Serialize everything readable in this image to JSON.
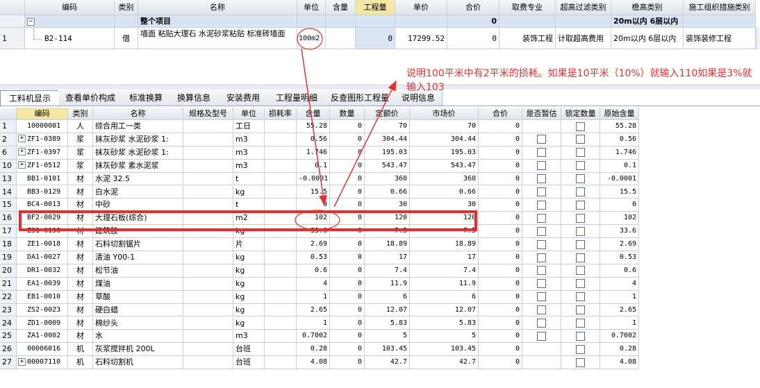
{
  "top_grid": {
    "columns": [
      "编码",
      "类别",
      "名称",
      "单位",
      "含量",
      "工程量",
      "单价",
      "合价",
      "取费专业",
      "超高过滤类别",
      "檐高类别",
      "施工组织措施类别"
    ],
    "group_row": {
      "minus": "−",
      "name": "整个项目",
      "total": "0",
      "eave": "20m以内 6层以内"
    },
    "item_row": {
      "row_num": "1",
      "code": "B2-114",
      "type": "借",
      "name": "墙面 粘贴大理石 水泥砂浆粘贴 标准砖墙面",
      "unit": "100m2",
      "quantity": "0",
      "unit_price": "17299.52",
      "total": "0",
      "fee_major": "装饰工程",
      "super_filter": "计取超高费用",
      "eave": "20m以内 6层以内",
      "measure_type": "装饰装修工程"
    }
  },
  "annotation": {
    "text": "说明100平米中有2平米的损耗。如果是10平米（10%）就输入110如果是3%就输入103",
    "color": "#e53030"
  },
  "tabs": [
    "工料机显示",
    "查看单价构成",
    "标准换算",
    "换算信息",
    "安装费用",
    "工程量明细",
    "反查图形工程量",
    "说明信息"
  ],
  "bottom_grid": {
    "columns": [
      "编码",
      "类别",
      "名称",
      "规格及型号",
      "单位",
      "损耗率",
      "含量",
      "数量",
      "定额价",
      "市场价",
      "合价",
      "是否暂估",
      "锁定数量",
      "原始含量"
    ],
    "rows": [
      {
        "n": "1",
        "plus": false,
        "code": "10000001",
        "type": "人",
        "name": "综合用工一类",
        "unit": "工日",
        "content": "55.28",
        "qty": "0",
        "quota": "70",
        "market": "70",
        "total": "0",
        "est": false,
        "lock": true,
        "orig": "55.28"
      },
      {
        "n": "2",
        "plus": true,
        "code": "ZF1-0389",
        "type": "浆",
        "name": "抹灰砂浆 水泥砂浆 1:",
        "unit": "m3",
        "content": "0.56",
        "qty": "0",
        "quota": "304.44",
        "market": "304.44",
        "total": "0",
        "est": true,
        "lock": true,
        "orig": "0.56"
      },
      {
        "n": "6",
        "plus": true,
        "code": "ZF1-0397",
        "type": "浆",
        "name": "抹灰砂浆 水泥砂浆 1:",
        "unit": "m3",
        "content": "1.746",
        "qty": "0",
        "quota": "195.03",
        "market": "195.03",
        "total": "0",
        "est": true,
        "lock": true,
        "orig": "1.746"
      },
      {
        "n": "10",
        "plus": true,
        "code": "ZF1-0512",
        "type": "浆",
        "name": "抹灰砂浆 素水泥浆",
        "unit": "m3",
        "content": "0.1",
        "qty": "0",
        "quota": "543.47",
        "market": "543.47",
        "total": "0",
        "est": true,
        "lock": true,
        "orig": "0.1"
      },
      {
        "n": "13",
        "plus": false,
        "code": "BB1-0101",
        "type": "材",
        "name": "水泥 32.5",
        "unit": "t",
        "content": "-0.0001",
        "qty": "0",
        "quota": "360",
        "market": "360",
        "total": "0",
        "est": true,
        "lock": true,
        "orig": "-0.0001"
      },
      {
        "n": "14",
        "plus": false,
        "code": "BB3-0129",
        "type": "材",
        "name": "白水泥",
        "unit": "kg",
        "content": "15.5",
        "qty": "0",
        "quota": "0.66",
        "market": "0.66",
        "total": "0",
        "est": true,
        "lock": true,
        "orig": "15.5"
      },
      {
        "n": "15",
        "plus": false,
        "code": "BC4-0013",
        "type": "材",
        "name": "中砂",
        "unit": "t",
        "content": "0",
        "qty": "0",
        "quota": "30",
        "market": "30",
        "total": "0",
        "est": true,
        "lock": true,
        "orig": "0"
      },
      {
        "n": "16",
        "plus": false,
        "code": "BF2-0029",
        "type": "材",
        "name": "大理石板(综合)",
        "unit": "m2",
        "content": "102",
        "qty": "0",
        "quota": "120",
        "market": "120",
        "total": "0",
        "est": true,
        "lock": true,
        "orig": "102"
      },
      {
        "n": "17",
        "plus": false,
        "code": "ZS1-0196",
        "type": "材",
        "name": "建筑胶",
        "unit": "kg",
        "content": "33.6",
        "qty": "0",
        "quota": "7.5",
        "market": "7.5",
        "total": "0",
        "est": true,
        "lock": true,
        "orig": "33.6"
      },
      {
        "n": "18",
        "plus": false,
        "code": "ZE1-0018",
        "type": "材",
        "name": "石料切割锯片",
        "unit": "片",
        "content": "2.69",
        "qty": "0",
        "quota": "18.89",
        "market": "18.89",
        "total": "0",
        "est": true,
        "lock": true,
        "orig": "2.69"
      },
      {
        "n": "19",
        "plus": false,
        "code": "DA1-0027",
        "type": "材",
        "name": "清油 Y00-1",
        "unit": "kg",
        "content": "0.53",
        "qty": "0",
        "quota": "17",
        "market": "17",
        "total": "0",
        "est": true,
        "lock": true,
        "orig": "0.53"
      },
      {
        "n": "20",
        "plus": false,
        "code": "DR1-0032",
        "type": "材",
        "name": "松节油",
        "unit": "kg",
        "content": "0.6",
        "qty": "0",
        "quota": "7.4",
        "market": "7.4",
        "total": "0",
        "est": true,
        "lock": true,
        "orig": "0.6"
      },
      {
        "n": "21",
        "plus": false,
        "code": "EA1-0039",
        "type": "材",
        "name": "煤油",
        "unit": "kg",
        "content": "4",
        "qty": "0",
        "quota": "11.9",
        "market": "11.9",
        "total": "0",
        "est": true,
        "lock": true,
        "orig": "4"
      },
      {
        "n": "22",
        "plus": false,
        "code": "EB1-0010",
        "type": "材",
        "name": "草酸",
        "unit": "kg",
        "content": "1",
        "qty": "0",
        "quota": "6",
        "market": "6",
        "total": "0",
        "est": true,
        "lock": true,
        "orig": "1"
      },
      {
        "n": "23",
        "plus": false,
        "code": "ZS2-0023",
        "type": "材",
        "name": "硬白蜡",
        "unit": "kg",
        "content": "2.65",
        "qty": "0",
        "quota": "12.07",
        "market": "12.07",
        "total": "0",
        "est": true,
        "lock": true,
        "orig": "2.65"
      },
      {
        "n": "24",
        "plus": false,
        "code": "ZD1-0009",
        "type": "材",
        "name": "棉纱头",
        "unit": "kg",
        "content": "1",
        "qty": "0",
        "quota": "5.83",
        "market": "5.83",
        "total": "0",
        "est": true,
        "lock": true,
        "orig": "1"
      },
      {
        "n": "25",
        "plus": false,
        "code": "ZA1-0002",
        "type": "材",
        "name": "水",
        "unit": "m3",
        "content": "0.7002",
        "qty": "0",
        "quota": "5",
        "market": "5",
        "total": "0",
        "est": true,
        "lock": true,
        "orig": "0.7002"
      },
      {
        "n": "26",
        "plus": false,
        "code": "00006016",
        "type": "机",
        "name": "灰浆搅拌机 200L",
        "unit": "台班",
        "content": "0.28",
        "qty": "0",
        "quota": "103.45",
        "market": "103.45",
        "total": "0",
        "est": false,
        "lock": true,
        "orig": "0.28"
      },
      {
        "n": "27",
        "plus": true,
        "code": "00007110",
        "type": "机",
        "name": "石料切割机",
        "unit": "台班",
        "content": "4.08",
        "qty": "0",
        "quota": "42.7",
        "market": "42.7",
        "total": "0",
        "est": false,
        "lock": true,
        "orig": "4.08"
      }
    ]
  }
}
